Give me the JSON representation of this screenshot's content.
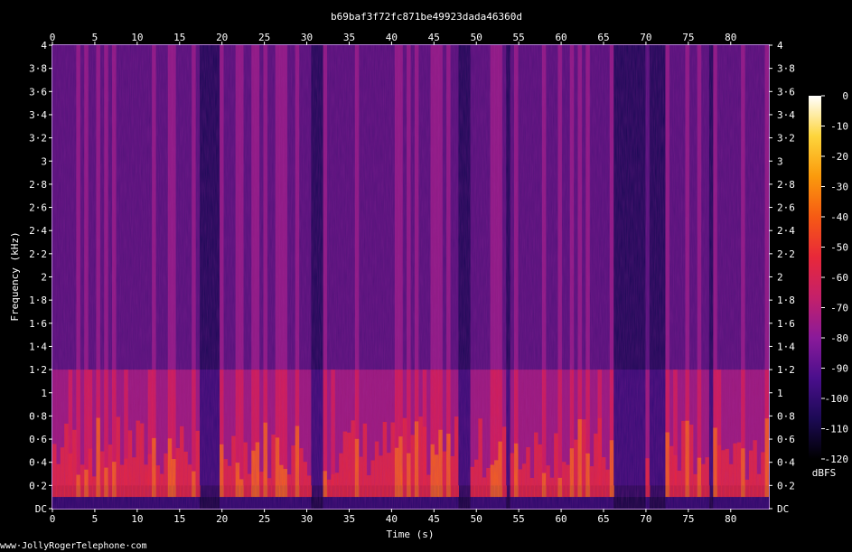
{
  "chart_data": {
    "type": "heatmap",
    "title": "b69baf3f72fc871be49923dada46360d",
    "xlabel": "Time (s)",
    "ylabel": "Frequency (kHz)",
    "xlim": [
      0,
      84.5
    ],
    "ylim": [
      0,
      4
    ],
    "x_ticks": [
      0,
      5,
      10,
      15,
      20,
      25,
      30,
      35,
      40,
      45,
      50,
      55,
      60,
      65,
      70,
      75,
      80
    ],
    "y_ticks": [
      {
        "value": 0,
        "label": "DC"
      },
      {
        "value": 0.2,
        "label": "0·2"
      },
      {
        "value": 0.4,
        "label": "0·4"
      },
      {
        "value": 0.6,
        "label": "0·6"
      },
      {
        "value": 0.8,
        "label": "0·8"
      },
      {
        "value": 1,
        "label": "1"
      },
      {
        "value": 1.2,
        "label": "1·2"
      },
      {
        "value": 1.4,
        "label": "1·4"
      },
      {
        "value": 1.6,
        "label": "1·6"
      },
      {
        "value": 1.8,
        "label": "1·8"
      },
      {
        "value": 2,
        "label": "2"
      },
      {
        "value": 2.2,
        "label": "2·2"
      },
      {
        "value": 2.4,
        "label": "2·4"
      },
      {
        "value": 2.6,
        "label": "2·6"
      },
      {
        "value": 2.8,
        "label": "2·8"
      },
      {
        "value": 3,
        "label": "3"
      },
      {
        "value": 3.2,
        "label": "3·2"
      },
      {
        "value": 3.4,
        "label": "3·4"
      },
      {
        "value": 3.6,
        "label": "3·6"
      },
      {
        "value": 3.8,
        "label": "3·8"
      },
      {
        "value": 4,
        "label": "4"
      }
    ],
    "colorbar": {
      "label": "dBFS",
      "range": [
        -120,
        0
      ],
      "ticks": [
        0,
        -10,
        -20,
        -30,
        -40,
        -50,
        -60,
        -70,
        -80,
        -90,
        -100,
        -110,
        -120
      ],
      "colors": [
        "#000000",
        "#1c0a55",
        "#4a0f8c",
        "#8a1a9a",
        "#c4206a",
        "#e8283a",
        "#f65a14",
        "#fb9a0c",
        "#fdd53c",
        "#ffffff"
      ]
    },
    "grid": false,
    "footer": "www·JollyRogerTelephone·com"
  }
}
